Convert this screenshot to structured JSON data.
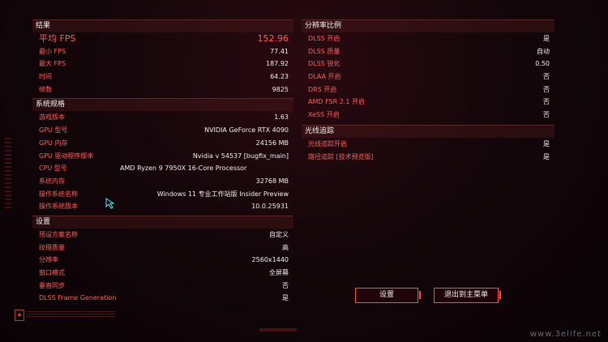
{
  "left": {
    "results": {
      "title": "结果",
      "avg_fps": {
        "label": "平均 FPS",
        "value": "152.96"
      },
      "rows": [
        {
          "label": "最小 FPS",
          "value": "77.41"
        },
        {
          "label": "最大 FPS",
          "value": "187.92"
        },
        {
          "label": "时间",
          "value": "64.23"
        },
        {
          "label": "帧数",
          "value": "9825"
        }
      ]
    },
    "specs": {
      "title": "系统规格",
      "rows": [
        {
          "label": "游戏版本",
          "value": "1.63"
        },
        {
          "label": "GPU 型号",
          "value": "NVIDIA GeForce RTX 4090"
        },
        {
          "label": "GPU 内存",
          "value": "24156 MB"
        },
        {
          "label": "GPU 驱动程序版本",
          "value": "Nvidia v 54537 [bugfix_main]"
        },
        {
          "label": "CPU 型号",
          "value": "AMD Ryzen 9 7950X 16-Core Processor"
        },
        {
          "label": "系统内存",
          "value": "32768 MB"
        },
        {
          "label": "操作系统名称",
          "value": "Windows 11 专业工作站版 Insider Preview"
        },
        {
          "label": "操作系统版本",
          "value": "10.0.25931"
        }
      ]
    },
    "settings": {
      "title": "设置",
      "rows": [
        {
          "label": "预设方案名称",
          "value": "自定义"
        },
        {
          "label": "纹理质量",
          "value": "高"
        },
        {
          "label": "分辨率",
          "value": "2560x1440"
        },
        {
          "label": "窗口模式",
          "value": "全屏幕"
        },
        {
          "label": "垂直同步",
          "value": "否"
        },
        {
          "label": "DLSS Frame Generation",
          "value": "是"
        }
      ]
    }
  },
  "right": {
    "resolution": {
      "title": "分辨率比例",
      "rows": [
        {
          "label": "DLSS 开启",
          "value": "是"
        },
        {
          "label": "DLSS 质量",
          "value": "自动"
        },
        {
          "label": "DLSS 锐化",
          "value": "0.50"
        },
        {
          "label": "DLAA 开启",
          "value": "否"
        },
        {
          "label": "DRS 开启",
          "value": "否"
        },
        {
          "label": "AMD FSR 2.1 开启",
          "value": "否"
        },
        {
          "label": "XeSS 开启",
          "value": "否"
        }
      ]
    },
    "raytracing": {
      "title": "光线追踪",
      "rows": [
        {
          "label": "光线追踪开启",
          "value": "是"
        },
        {
          "label": "路径追踪 [技术预览版]",
          "value": "是"
        }
      ]
    }
  },
  "buttons": {
    "settings": "设置",
    "exit": "退出到主菜单"
  },
  "watermark": "www.3elife.net",
  "colors": {
    "accent": "#ff5e5b",
    "cyan": "#5ef0ff"
  }
}
